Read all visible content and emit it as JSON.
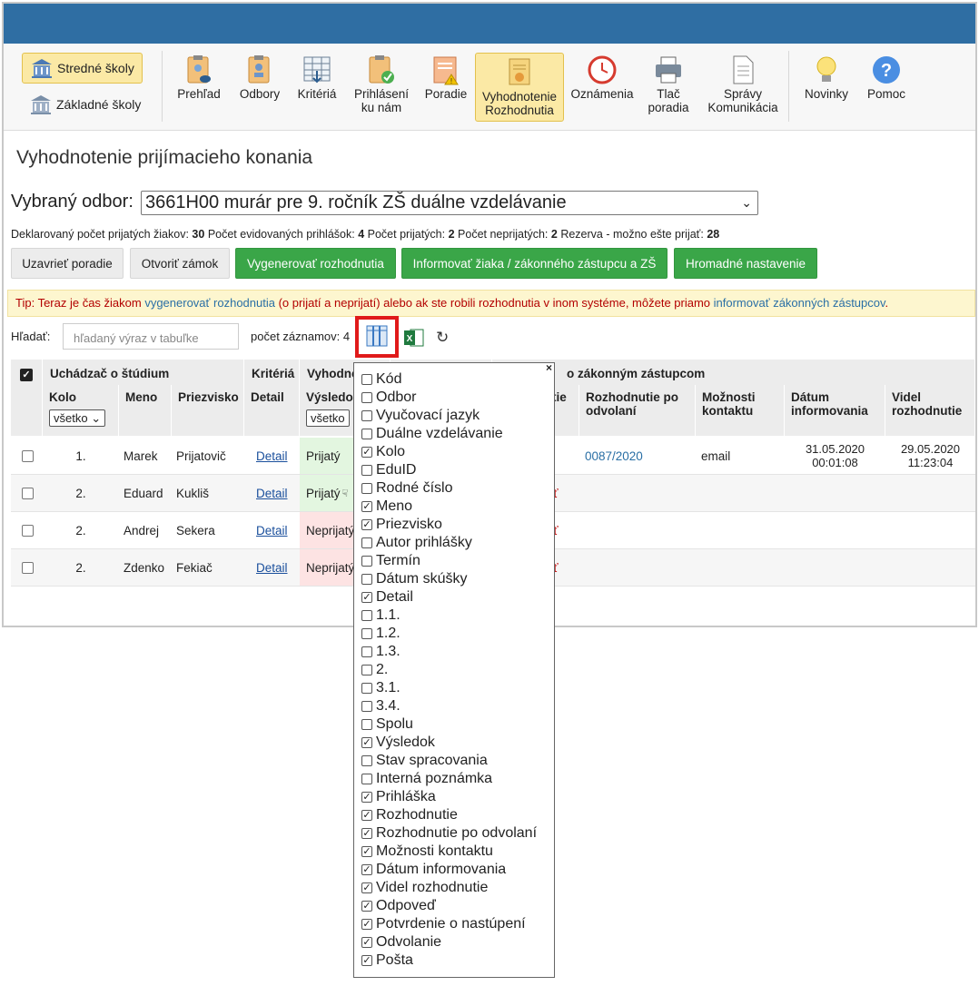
{
  "school_types": [
    {
      "label": "Stredné školy",
      "active": true
    },
    {
      "label": "Základné školy",
      "active": false
    }
  ],
  "ribbon": [
    {
      "name": "prehlad",
      "line1": "Prehľad",
      "line2": "",
      "icon": "clipboard-eye-icon",
      "active": false
    },
    {
      "name": "odbory",
      "line1": "Odbory",
      "line2": "",
      "icon": "clipboard-search-icon",
      "active": false
    },
    {
      "name": "kriteria",
      "line1": "Kritériá",
      "line2": "",
      "icon": "table-icon",
      "active": false
    },
    {
      "name": "prihlaseni",
      "line1": "Prihlásení",
      "line2": "ku nám",
      "icon": "clipboard-check-icon",
      "active": false
    },
    {
      "name": "poradie",
      "line1": "Poradie",
      "line2": "",
      "icon": "list-warning-icon",
      "active": false
    },
    {
      "name": "vyhodnotenie",
      "line1": "Vyhodnotenie",
      "line2": "Rozhodnutia",
      "icon": "certificate-icon",
      "active": true
    },
    {
      "name": "oznamenia",
      "line1": "Oznámenia",
      "line2": "",
      "icon": "clock-arrow-icon",
      "active": false
    },
    {
      "name": "tlac",
      "line1": "Tlač",
      "line2": "poradia",
      "icon": "printer-icon",
      "active": false
    },
    {
      "name": "spravy",
      "line1": "Správy",
      "line2": "Komunikácia",
      "icon": "document-icon",
      "active": false
    },
    {
      "name": "novinky",
      "line1": "Novinky",
      "line2": "",
      "icon": "lightbulb-icon",
      "active": false
    },
    {
      "name": "pomoc",
      "line1": "Pomoc",
      "line2": "",
      "icon": "help-icon",
      "active": false
    }
  ],
  "page_title": "Vyhodnotenie prijímacieho konania",
  "odbor": {
    "label": "Vybraný odbor:",
    "value": "3661H00 murár pre 9. ročník ZŠ duálne vzdelávanie"
  },
  "stats": [
    {
      "label": "Deklarovaný počet prijatých žiakov:",
      "value": "30"
    },
    {
      "label": "Počet evidovaných prihlášok:",
      "value": "4"
    },
    {
      "label": "Počet prijatých:",
      "value": "2"
    },
    {
      "label": "Počet neprijatých:",
      "value": "2"
    },
    {
      "label": "Rezerva - možno ešte prijať:",
      "value": "28"
    }
  ],
  "buttons": {
    "uzavriet": "Uzavrieť poradie",
    "otvorit": "Otvoriť zámok",
    "vygenerovat": "Vygenerovať rozhodnutia",
    "informovat": "Informovať žiaka / zákonného zástupcu a ZŠ",
    "hromadne": "Hromadné nastavenie"
  },
  "tip": {
    "prefix": "Tip: Teraz je čas žiakom ",
    "link1": "vygenerovať rozhodnutia",
    "middle": " (o prijatí a neprijatí) alebo ak ste robili rozhodnutia v inom systéme, môžete priamo ",
    "link2": "informovať zákonných zástupcov",
    "suffix": "."
  },
  "search": {
    "label": "Hľadať:",
    "placeholder": "hľadaný výraz v tabuľke"
  },
  "count_label": "počet záznamov: 4",
  "table": {
    "groups": {
      "uchadzac": "Uchádzač o štúdium",
      "kriteria": "Kritériá",
      "vyhodno": "Vyhodno",
      "zastupcom": "o zákonným zástupcom"
    },
    "headers": {
      "kolo": "Kolo",
      "meno": "Meno",
      "priezvisko": "Priezvisko",
      "detail": "Detail",
      "vysledok": "Výsledok",
      "tie": "tie",
      "rozh_odv": "Rozhodnutie po odvolaní",
      "moznosti": "Možnosti kontaktu",
      "datum": "Dátum informovania",
      "videl": "Videl rozhodnutie"
    },
    "filters": {
      "kolo": "všetko",
      "vysledok": "všetko"
    },
    "rows": [
      {
        "kolo": "1.",
        "meno": "Marek",
        "priezvisko": "Prijatovič",
        "detail": "Detail",
        "vysledok": "Prijatý",
        "vysl_ok": true,
        "partial": "",
        "rozh_odv": "0087/2020",
        "moznosti": "email",
        "datum1": "31.05.2020",
        "datum2": "00:01:08",
        "videl1": "29.05.2020",
        "videl2": "11:23:04"
      },
      {
        "kolo": "2.",
        "meno": "Eduard",
        "priezvisko": "Kukliš",
        "detail": "Detail",
        "vysledok": "Prijatý",
        "vysl_ok": true,
        "partial": "ať",
        "rozh_odv": "",
        "moznosti": "",
        "datum1": "",
        "datum2": "",
        "videl1": "",
        "videl2": ""
      },
      {
        "kolo": "2.",
        "meno": "Andrej",
        "priezvisko": "Sekera",
        "detail": "Detail",
        "vysledok": "Neprijatý",
        "vysl_ok": false,
        "partial": "ať",
        "rozh_odv": "",
        "moznosti": "",
        "datum1": "",
        "datum2": "",
        "videl1": "",
        "videl2": ""
      },
      {
        "kolo": "2.",
        "meno": "Zdenko",
        "priezvisko": "Fekiač",
        "detail": "Detail",
        "vysledok": "Neprijatý",
        "vysl_ok": false,
        "partial": "ať",
        "rozh_odv": "",
        "moznosti": "",
        "datum1": "",
        "datum2": "",
        "videl1": "",
        "videl2": ""
      }
    ]
  },
  "column_picker": {
    "close": "×",
    "options": [
      {
        "label": "Kód",
        "checked": false
      },
      {
        "label": "Odbor",
        "checked": false
      },
      {
        "label": "Vyučovací jazyk",
        "checked": false
      },
      {
        "label": "Duálne vzdelávanie",
        "checked": false
      },
      {
        "label": "Kolo",
        "checked": true
      },
      {
        "label": "EduID",
        "checked": false
      },
      {
        "label": "Rodné číslo",
        "checked": false
      },
      {
        "label": "Meno",
        "checked": true
      },
      {
        "label": "Priezvisko",
        "checked": true
      },
      {
        "label": "Autor prihlášky",
        "checked": false
      },
      {
        "label": "Termín",
        "checked": false
      },
      {
        "label": "Dátum skúšky",
        "checked": false
      },
      {
        "label": "Detail",
        "checked": true
      },
      {
        "label": "1.1.",
        "checked": false
      },
      {
        "label": "1.2.",
        "checked": false
      },
      {
        "label": "1.3.",
        "checked": false
      },
      {
        "label": " 2.",
        "checked": false
      },
      {
        "label": "3.1.",
        "checked": false
      },
      {
        "label": "3.4.",
        "checked": false
      },
      {
        "label": "Spolu",
        "checked": false
      },
      {
        "label": "Výsledok",
        "checked": true
      },
      {
        "label": "Stav spracovania",
        "checked": false
      },
      {
        "label": "Interná poznámka",
        "checked": false
      },
      {
        "label": "Prihláška",
        "checked": true
      },
      {
        "label": "Rozhodnutie",
        "checked": true
      },
      {
        "label": "Rozhodnutie po odvolaní",
        "checked": true
      },
      {
        "label": "Možnosti kontaktu",
        "checked": true
      },
      {
        "label": "Dátum informovania",
        "checked": true
      },
      {
        "label": "Videl rozhodnutie",
        "checked": true
      },
      {
        "label": "Odpoveď",
        "checked": true
      },
      {
        "label": "Potvrdenie o nastúpení",
        "checked": true
      },
      {
        "label": "Odvolanie",
        "checked": true
      },
      {
        "label": "Pošta",
        "checked": true
      }
    ]
  },
  "colors": {
    "header": "#2f6ea3",
    "ok_bg": "#e3f6e0",
    "bad_bg": "#fde3e3",
    "accent": "#fbe9a5",
    "green": "#3aa648",
    "tip_text": "#b30000"
  }
}
